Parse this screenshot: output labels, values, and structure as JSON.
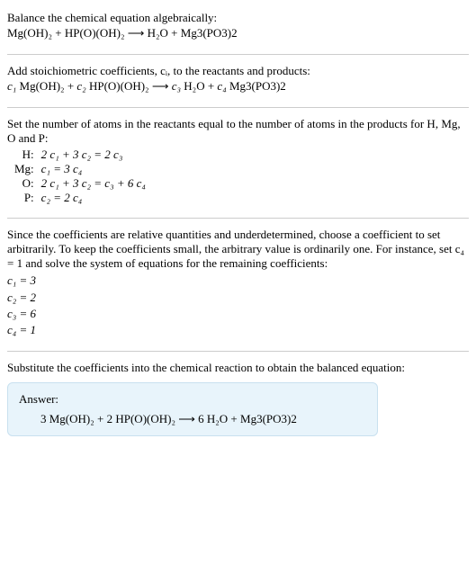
{
  "intro_line": "Balance the chemical equation algebraically:",
  "eq1": "Mg(OH)₂ + HP(O)(OH)₂  ⟶  H₂O + Mg3(PO3)2",
  "step1": "Add stoichiometric coefficients, cᵢ, to the reactants and products:",
  "eq2_c1": "c₁",
  "eq2_r1": " Mg(OH)₂ + ",
  "eq2_c2": "c₂",
  "eq2_r2": " HP(O)(OH)₂  ⟶  ",
  "eq2_c3": "c₃",
  "eq2_r3": " H₂O + ",
  "eq2_c4": "c₄",
  "eq2_r4": " Mg3(PO3)2",
  "step2": "Set the number of atoms in the reactants equal to the number of atoms in the products for H, Mg, O and P:",
  "atoms": [
    {
      "label": "H:",
      "eq": "2 c₁ + 3 c₂ = 2 c₃"
    },
    {
      "label": "Mg:",
      "eq": "c₁ = 3 c₄"
    },
    {
      "label": "O:",
      "eq": "2 c₁ + 3 c₂ = c₃ + 6 c₄"
    },
    {
      "label": "P:",
      "eq": "c₂ = 2 c₄"
    }
  ],
  "step3": "Since the coefficients are relative quantities and underdetermined, choose a coefficient to set arbitrarily. To keep the coefficients small, the arbitrary value is ordinarily one. For instance, set c₄ = 1 and solve the system of equations for the remaining coefficients:",
  "solutions": [
    "c₁ = 3",
    "c₂ = 2",
    "c₃ = 6",
    "c₄ = 1"
  ],
  "step4": "Substitute the coefficients into the chemical reaction to obtain the balanced equation:",
  "answer_label": "Answer:",
  "answer_eq": "3 Mg(OH)₂ + 2 HP(O)(OH)₂  ⟶  6 H₂O + Mg3(PO3)2"
}
